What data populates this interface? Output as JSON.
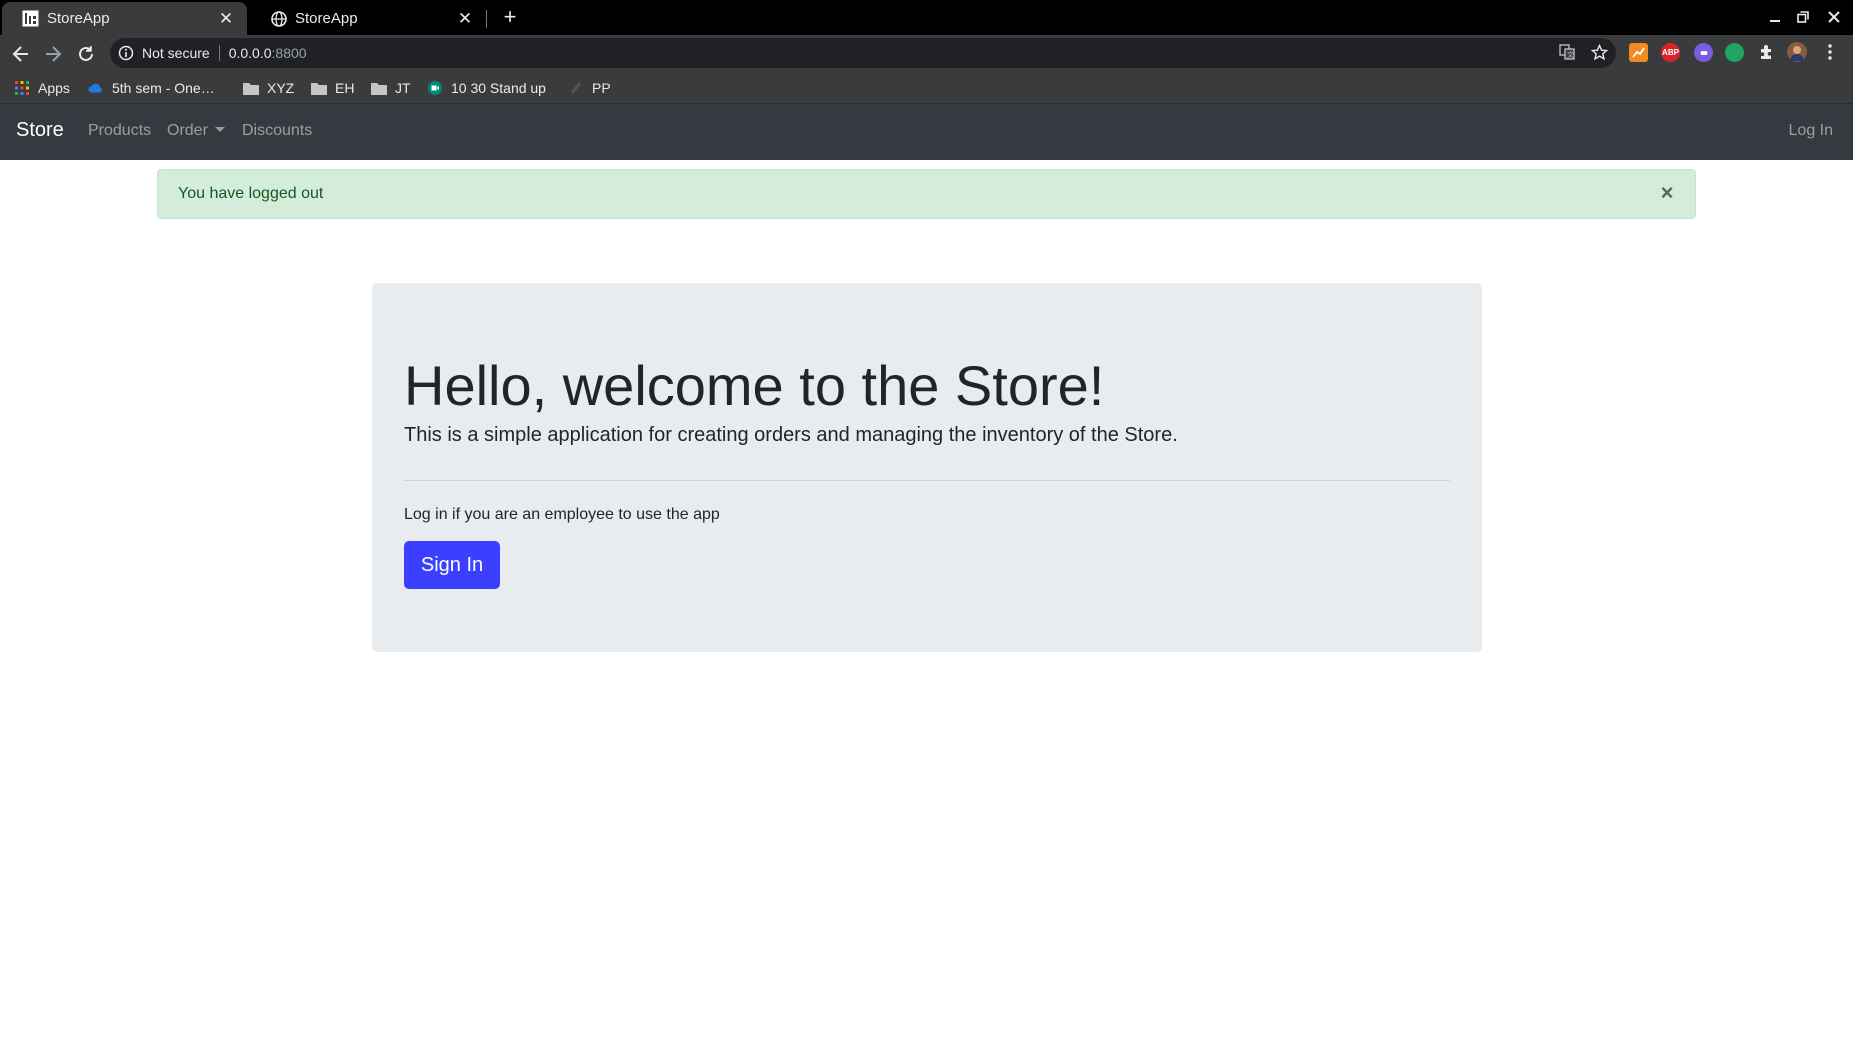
{
  "browser": {
    "tabs": [
      {
        "title": "StoreApp",
        "icon": "storeapp-favicon",
        "active": true
      },
      {
        "title": "StoreApp",
        "icon": "globe-icon",
        "active": false
      }
    ],
    "address": {
      "security_label": "Not secure",
      "host": "0.0.0.0",
      "port": ":8800"
    },
    "bookmarks": [
      {
        "label": "Apps",
        "icon": "apps-grid-icon"
      },
      {
        "label": "5th sem - One…",
        "icon": "onedrive-cloud-icon"
      },
      {
        "label": "XYZ",
        "icon": "folder-icon"
      },
      {
        "label": "EH",
        "icon": "folder-icon"
      },
      {
        "label": "JT",
        "icon": "folder-icon"
      },
      {
        "label": "10 30 Stand up",
        "icon": "meet-icon"
      },
      {
        "label": "PP",
        "icon": "page-icon"
      }
    ],
    "extensions": {
      "abp_label": "ABP"
    }
  },
  "navbar": {
    "brand": "Store",
    "links": {
      "products": "Products",
      "order": "Order",
      "discounts": "Discounts"
    },
    "login": "Log In"
  },
  "alert": {
    "message": "You have logged out",
    "close_symbol": "×"
  },
  "jumbotron": {
    "title": "Hello, welcome to the Store!",
    "lead": "This is a simple application for creating orders and managing the inventory of the Store.",
    "subtext": "Log in if you are an employee to use the app",
    "button_label": "Sign In"
  },
  "colors": {
    "navbar_bg": "#343a40",
    "alert_bg": "#d4edda",
    "alert_text": "#155724",
    "jumbotron_bg": "#e9ecef",
    "primary_button": "#3b3fff"
  }
}
